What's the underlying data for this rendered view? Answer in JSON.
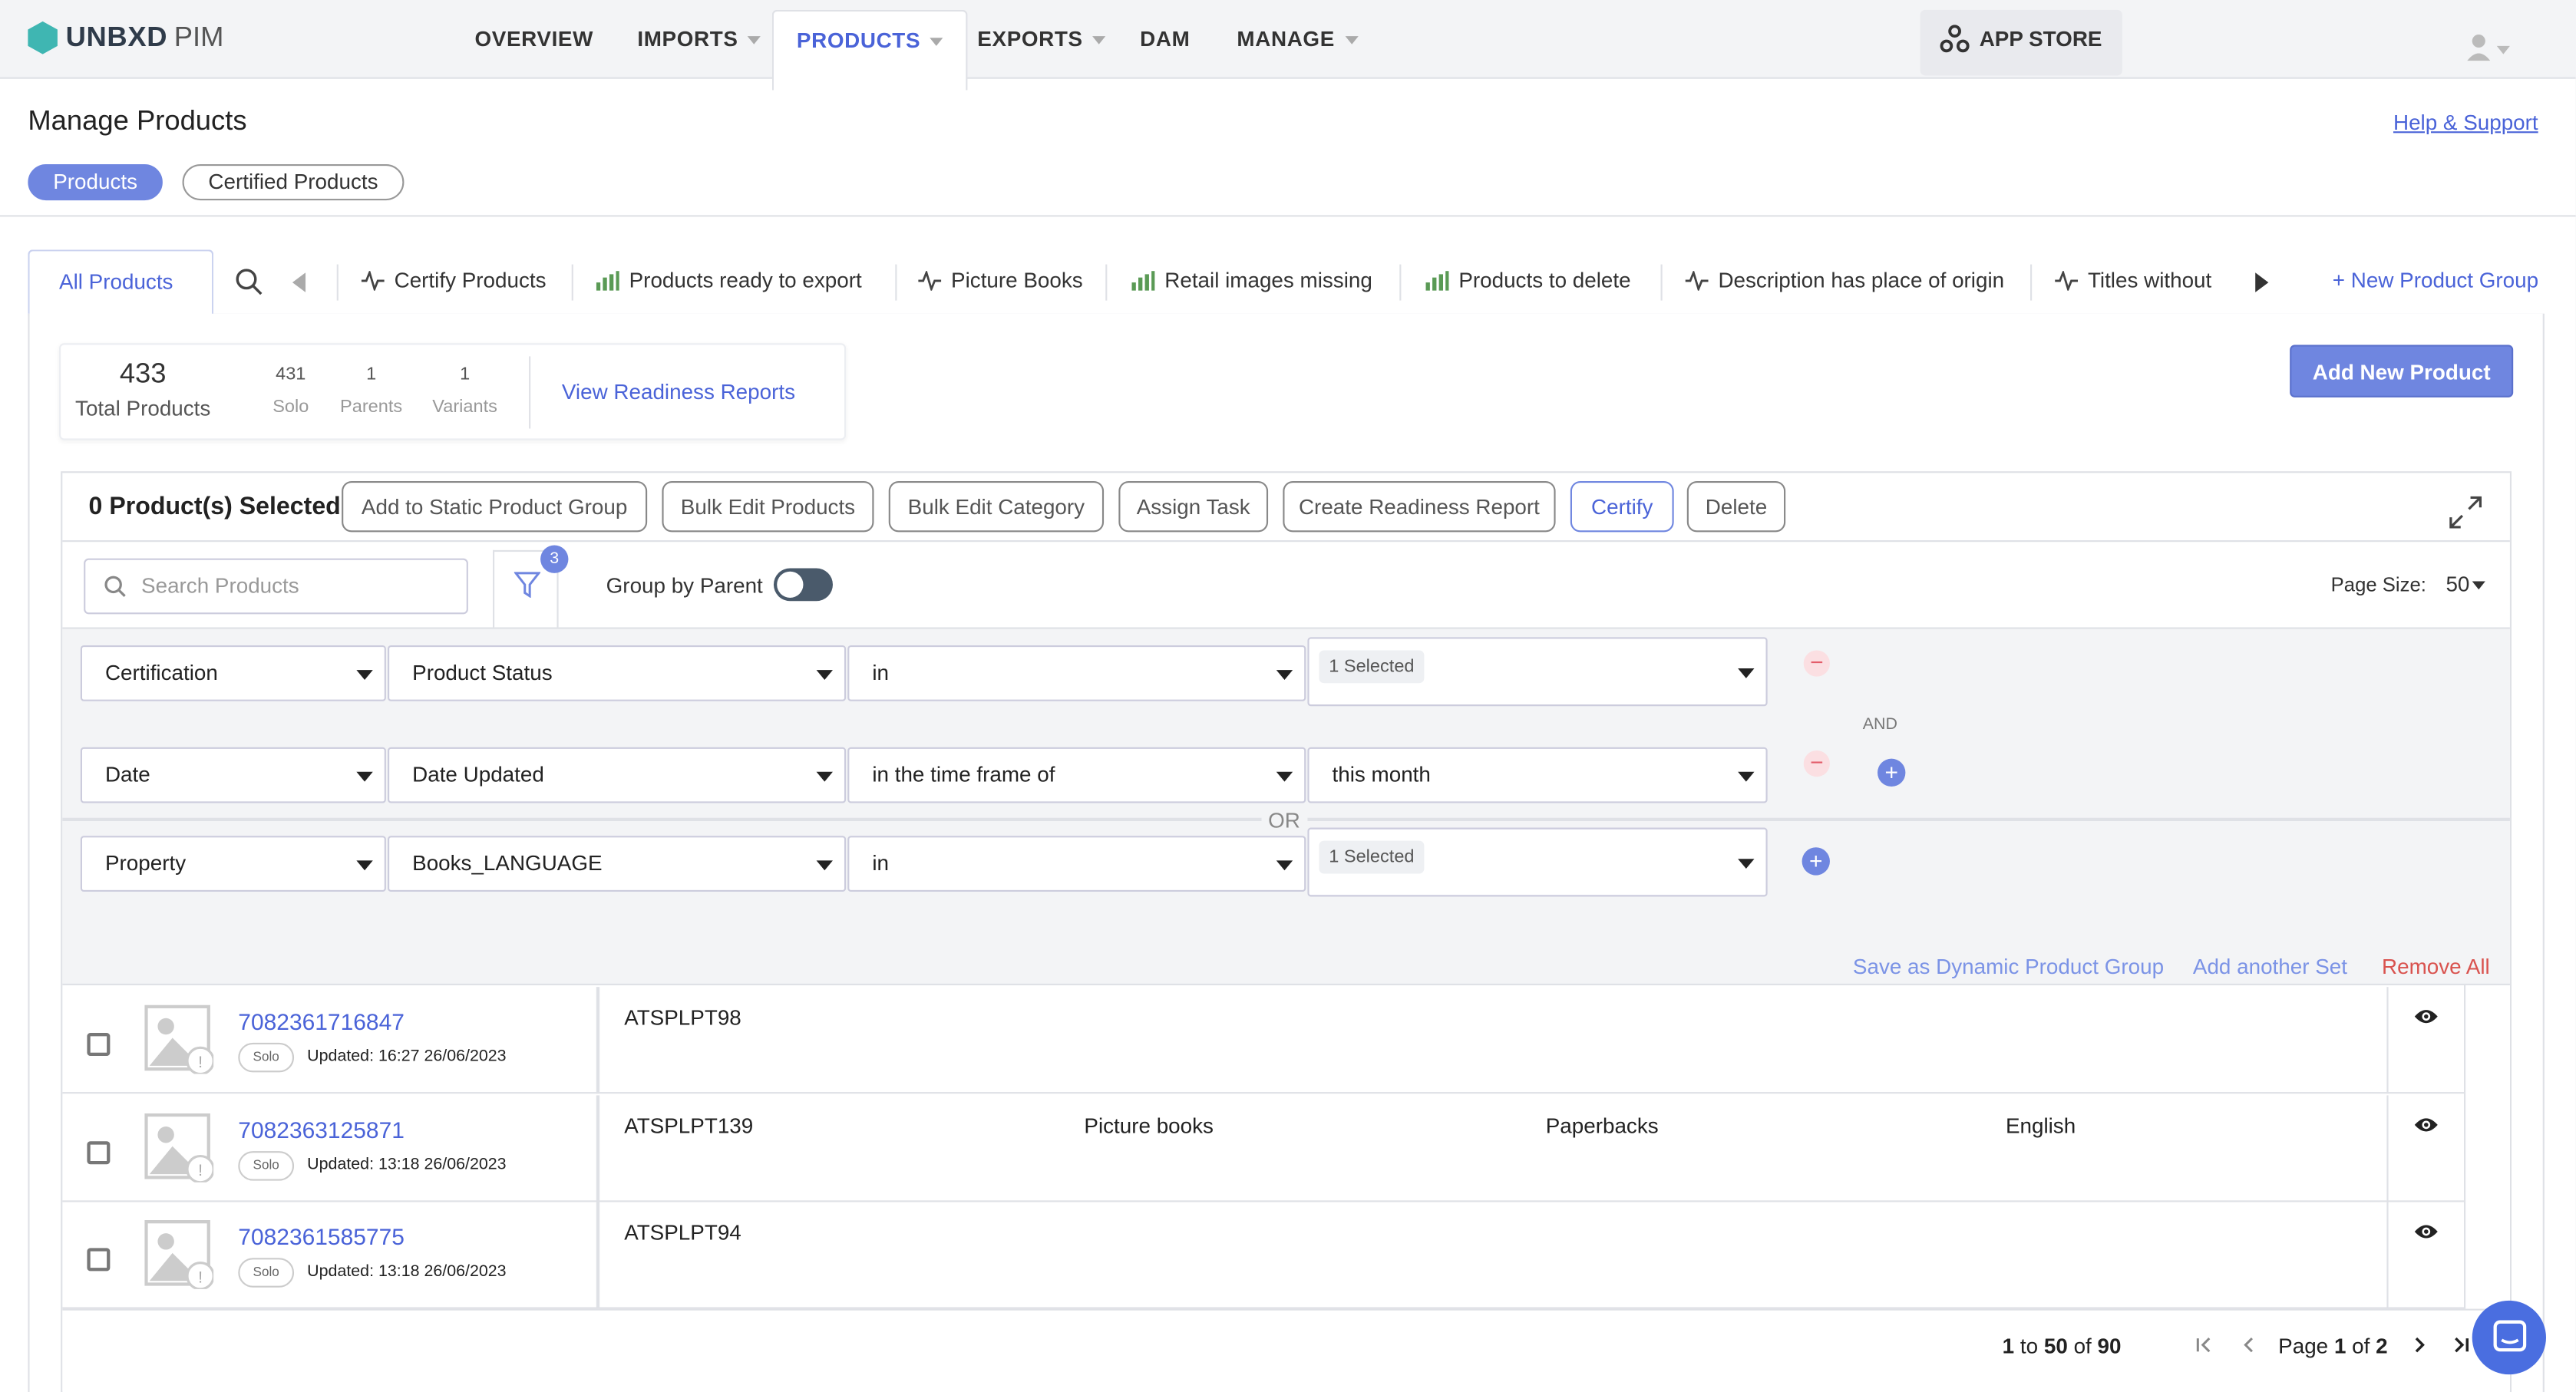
{
  "brand": {
    "name": "UNBXD",
    "suffix": "PIM"
  },
  "nav": {
    "overview": "OVERVIEW",
    "imports": "IMPORTS",
    "products": "PRODUCTS",
    "exports": "EXPORTS",
    "dam": "DAM",
    "manage": "MANAGE",
    "app_store": "APP STORE"
  },
  "page": {
    "title": "Manage Products",
    "help": "Help & Support",
    "pills": {
      "products": "Products",
      "certified": "Certified Products"
    }
  },
  "groups": {
    "all": "All Products",
    "items": [
      "Certify Products",
      "Products ready to export",
      "Picture Books",
      "Retail images missing",
      "Products to delete",
      "Description has place of origin",
      "Titles without"
    ],
    "new_group": "+ New Product Group"
  },
  "stats": {
    "total": "433",
    "total_label": "Total Products",
    "solo": "431",
    "solo_label": "Solo",
    "parents": "1",
    "parents_label": "Parents",
    "variants": "1",
    "variants_label": "Variants",
    "readiness": "View Readiness Reports"
  },
  "add_product": "Add New Product",
  "actions": {
    "selected": "0 Product(s) Selected",
    "static_group": "Add to Static Product Group",
    "bulk_edit": "Bulk Edit Products",
    "bulk_cat": "Bulk Edit Category",
    "assign": "Assign Task",
    "readiness": "Create Readiness Report",
    "certify": "Certify",
    "delete": "Delete"
  },
  "toolbar": {
    "search_placeholder": "Search Products",
    "filter_count": "3",
    "group_by_parent": "Group by Parent",
    "page_size_label": "Page Size:",
    "page_size": "50"
  },
  "filters": {
    "set1": [
      {
        "field": "Certification",
        "attr": "Product Status",
        "op": "in",
        "value": "1 Selected",
        "chip": true
      },
      {
        "field": "Date",
        "attr": "Date Updated",
        "op": "in the time frame of",
        "value": "this month",
        "chip": false
      }
    ],
    "and_label": "AND",
    "or_label": "OR",
    "set2": [
      {
        "field": "Property",
        "attr": "Books_LANGUAGE",
        "op": "in",
        "value": "1 Selected",
        "chip": true
      }
    ],
    "save_dynamic": "Save as Dynamic Product Group",
    "add_set": "Add another Set",
    "remove_all": "Remove All"
  },
  "rows": [
    {
      "id": "7082361716847",
      "type": "Solo",
      "updated": "Updated: 16:27 26/06/2023",
      "sku": "ATSPLPT98",
      "genre": "",
      "format": "",
      "language": ""
    },
    {
      "id": "7082363125871",
      "type": "Solo",
      "updated": "Updated: 13:18 26/06/2023",
      "sku": "ATSPLPT139",
      "genre": "Picture books",
      "format": "Paperbacks",
      "language": "English"
    },
    {
      "id": "7082361585775",
      "type": "Solo",
      "updated": "Updated: 13:18 26/06/2023",
      "sku": "ATSPLPT94",
      "genre": "",
      "format": "",
      "language": ""
    }
  ],
  "pagination": {
    "range_start": "1",
    "to": "to",
    "range_end": "50",
    "of": "of",
    "total": "90",
    "page_label": "Page",
    "page": "1",
    "page_of": "of",
    "pages": "2"
  },
  "colors": {
    "accent": "#6f86e0",
    "link": "#4a63d8",
    "danger": "#d9534f"
  }
}
